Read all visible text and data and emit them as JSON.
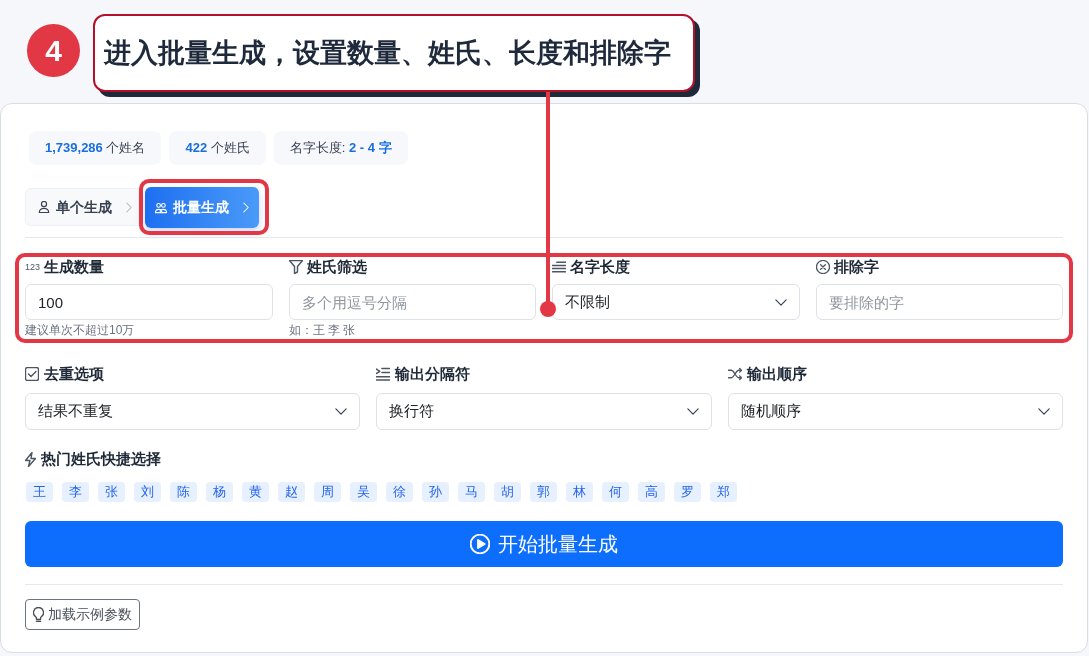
{
  "annotation": {
    "step": "4",
    "caption": "进入批量生成，设置数量、姓氏、长度和排除字"
  },
  "stats": [
    "**1,739,286** 个姓名",
    "**422** 个姓氏",
    "名字长度: **2 - 4 字**"
  ],
  "tabs": [
    {
      "label": "单个生成",
      "selected": false,
      "highlighted": false
    },
    {
      "label": "批量生成",
      "selected": true,
      "highlighted": true
    }
  ],
  "primary_fields": {
    "highlighted": true,
    "items": [
      {
        "kind": "input",
        "icon_text": "123",
        "label": "生成数量",
        "value": "100",
        "hint": "建议单次不超过10万"
      },
      {
        "kind": "input",
        "label": "姓氏筛选",
        "placeholder": "多个用逗号分隔",
        "hint": "如：王 李 张"
      },
      {
        "kind": "select",
        "label": "名字长度",
        "value": "不限制"
      },
      {
        "kind": "input",
        "label": "排除字",
        "placeholder": "要排除的字"
      }
    ]
  },
  "options": [
    {
      "label": "去重选项",
      "value": "结果不重复"
    },
    {
      "label": "输出分隔符",
      "value": "换行符"
    },
    {
      "label": "输出顺序",
      "value": "随机顺序"
    }
  ],
  "hot_surnames": {
    "label": "热门姓氏快捷选择",
    "items": [
      "王",
      "李",
      "张",
      "刘",
      "陈",
      "杨",
      "黄",
      "赵",
      "周",
      "吴",
      "徐",
      "孙",
      "马",
      "胡",
      "郭",
      "林",
      "何",
      "高",
      "罗",
      "郑"
    ]
  },
  "generate_button": "开始批量生成",
  "example_button": "加载示例参数"
}
